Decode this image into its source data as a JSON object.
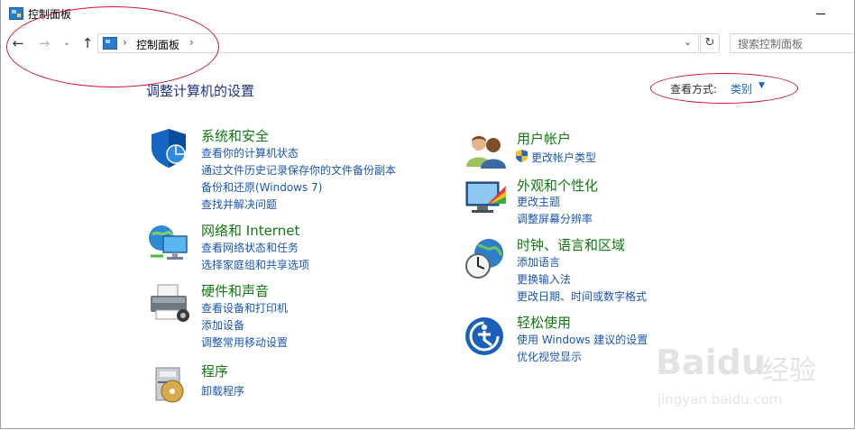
{
  "window": {
    "title": "控制面板"
  },
  "nav": {
    "back_icon": "←",
    "forward_icon": "→",
    "recent_icon": "⌄",
    "up_icon": "↑",
    "address_sep": "›",
    "address_text": "控制面板",
    "dropdown_icon": "⌄",
    "refresh_icon": "↻",
    "search_placeholder": "搜索控制面板"
  },
  "main": {
    "heading": "调整计算机的设置",
    "view_by_label": "查看方式:",
    "view_by_value": "类别",
    "view_by_caret": "▼"
  },
  "left_categories": [
    {
      "title": "系统和安全",
      "icon": "shield-icon",
      "links": [
        "查看你的计算机状态",
        "通过文件历史记录保存你的文件备份副本",
        "备份和还原(Windows 7)",
        "查找并解决问题"
      ]
    },
    {
      "title": "网络和 Internet",
      "icon": "network-icon",
      "links": [
        "查看网络状态和任务",
        "选择家庭组和共享选项"
      ]
    },
    {
      "title": "硬件和声音",
      "icon": "printer-icon",
      "links": [
        "查看设备和打印机",
        "添加设备",
        "调整常用移动设置"
      ]
    },
    {
      "title": "程序",
      "icon": "programs-icon",
      "links": [
        "卸载程序"
      ]
    }
  ],
  "right_categories": [
    {
      "title": "用户帐户",
      "icon": "users-icon",
      "links": [
        "更改帐户类型"
      ]
    },
    {
      "title": "外观和个性化",
      "icon": "appearance-icon",
      "links": [
        "更改主题",
        "调整屏幕分辨率"
      ]
    },
    {
      "title": "时钟、语言和区域",
      "icon": "clock-globe-icon",
      "links": [
        "添加语言",
        "更换输入法",
        "更改日期、时间或数字格式"
      ]
    },
    {
      "title": "轻松使用",
      "icon": "ease-of-access-icon",
      "links": [
        "使用 Windows 建议的设置",
        "优化视觉显示"
      ]
    }
  ],
  "watermark": {
    "brand": "Baidu",
    "brand_cn": "经验",
    "url": "jingyan.baidu.com"
  },
  "colors": {
    "heading": "#1e3287",
    "category_title": "#0f7a0f",
    "link": "#1a56b3",
    "annotation": "#d0142c"
  }
}
